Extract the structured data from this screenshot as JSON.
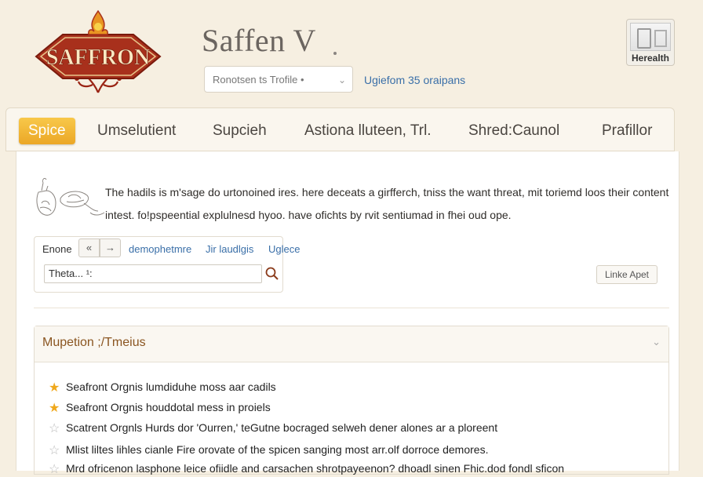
{
  "header": {
    "logo_text": "SAFFRON",
    "title": "Saffen V",
    "search_select_value": "Ronotsen ts Trofile •",
    "link": "Ugiefom 35 oraipans",
    "user_label": "Herealth"
  },
  "nav": {
    "tabs": [
      {
        "label": "Spice"
      },
      {
        "label": "Umselutient"
      },
      {
        "label": "Supcieh"
      },
      {
        "label": "Astiona lluteen, Trl."
      },
      {
        "label": "Shred:Caunol"
      },
      {
        "label": "Prafillor"
      }
    ]
  },
  "intro": {
    "text": "The hadils is m'sage do urtonoined ires. here deceats a girfferch, tniss the want threat, mit toriemd loos their content intest. fo!pspeential explulnesd hyoo. have ofichts by rvit sentiumad in fhei oud ope."
  },
  "tools": {
    "label": "Enone",
    "prev": "«",
    "next": "→",
    "links": [
      "demophetmre",
      "Jir laudlgis",
      "Uglece"
    ],
    "search_value": "Theta... ¹:",
    "right_button": "Linke Apet"
  },
  "section": {
    "title": "Mupetion ;/Tmeius",
    "items": [
      {
        "text": "Seafront Orgnis lumdiduhe moss aar cadils",
        "star": "full"
      },
      {
        "text": "Seafront Orgnis houddotal mess in proiels",
        "star": "full"
      },
      {
        "text": "Scatrent Orgnls Hurds dor 'Ourren,' teGutne bocraged selweh dener alones ar a ploreent",
        "star": "empty"
      },
      {
        "text": "Mlist liltes lihles cianle Fire orovate of the spicen sanging most arr.olf dorroce demores.",
        "star": "empty"
      },
      {
        "text": "Mrd ofricenon lasphone leice ofiidle and carsachen shrotpayeenon? dhoadl sinen Fhic.dod fondl sficon",
        "star": "empty"
      }
    ]
  }
}
